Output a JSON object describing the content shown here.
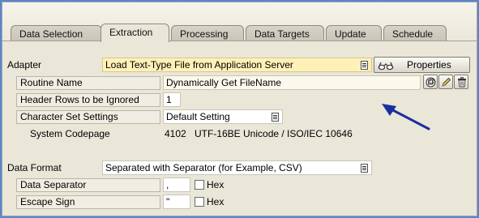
{
  "tabs": [
    {
      "label": "Data Selection"
    },
    {
      "label": "Extraction"
    },
    {
      "label": "Processing"
    },
    {
      "label": "Data Targets"
    },
    {
      "label": "Update"
    },
    {
      "label": "Schedule"
    }
  ],
  "active_tab": "Extraction",
  "adapter": {
    "label": "Adapter",
    "value": "Load Text-Type File from Application Server",
    "properties_button": "Properties"
  },
  "routine_name": {
    "label": "Routine Name",
    "value": "Dynamically Get FileName"
  },
  "header_rows": {
    "label": "Header Rows to be Ignored",
    "value": "1"
  },
  "charset": {
    "label": "Character Set Settings",
    "value": "Default Setting"
  },
  "codepage": {
    "label": "System Codepage",
    "code": "4102",
    "description": "UTF-16BE Unicode / ISO/IEC 10646"
  },
  "data_format": {
    "label": "Data Format",
    "value": "Separated with Separator (for Example, CSV)"
  },
  "data_separator": {
    "label": "Data Separator",
    "value": ",",
    "hex_label": "Hex"
  },
  "escape_sign": {
    "label": "Escape Sign",
    "value": "\"",
    "hex_label": "Hex"
  },
  "colors": {
    "background_frame": "#5b86c6",
    "highlight_field": "#fff0b8",
    "arrow": "#1a2ea0"
  },
  "icons": [
    "dropdown-list-icon",
    "glasses-icon",
    "create-copy-icon",
    "edit-pencil-icon",
    "delete-trash-icon"
  ]
}
